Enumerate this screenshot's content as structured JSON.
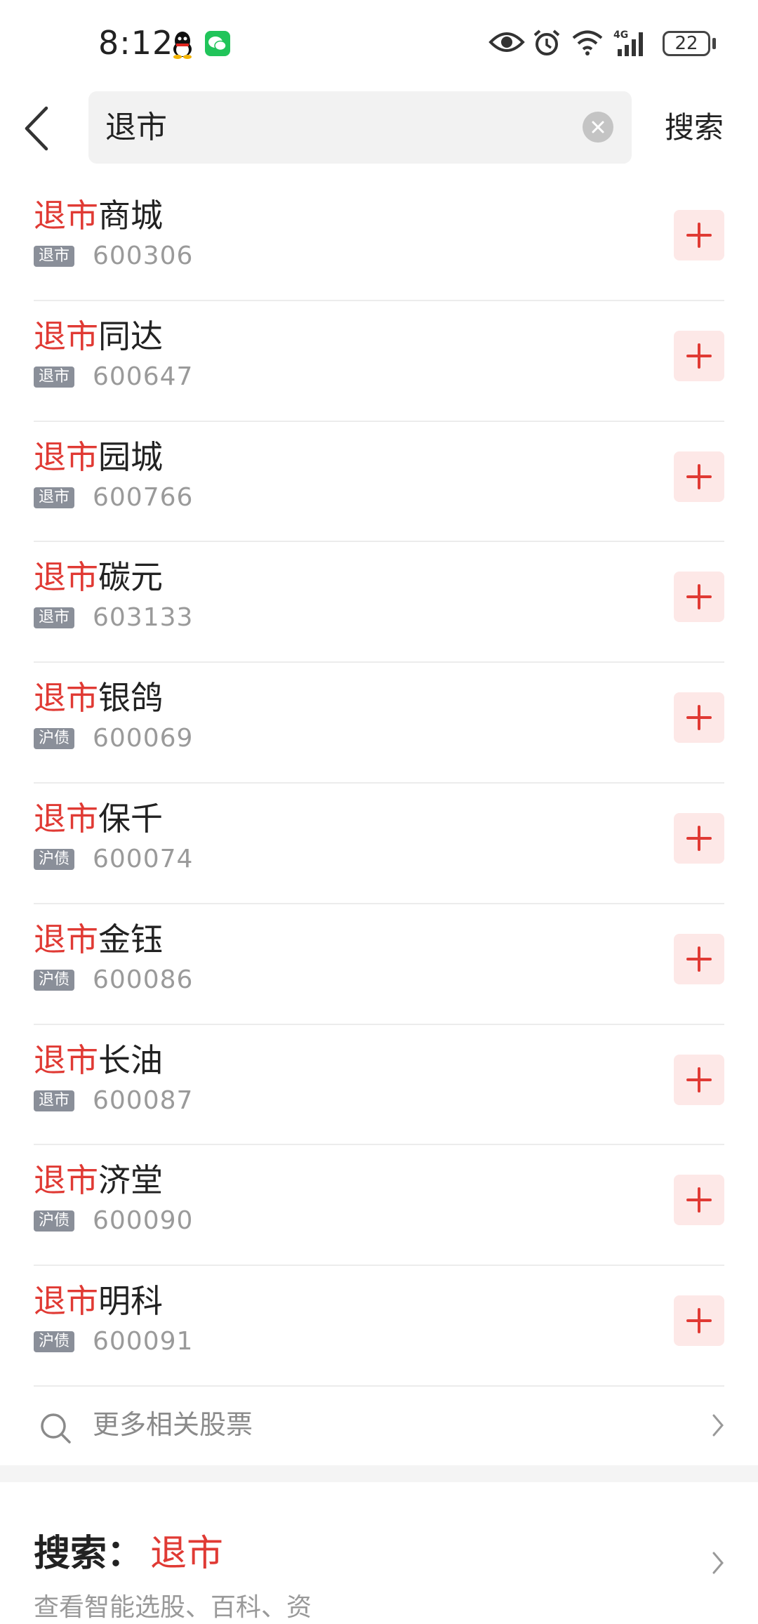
{
  "status_bar": {
    "time": "8:12",
    "battery": "22",
    "network": "4G"
  },
  "search": {
    "query": "退市",
    "submit_label": "搜索"
  },
  "results": [
    {
      "highlight": "退市",
      "rest": "商城",
      "tag": "退市",
      "code": "600306"
    },
    {
      "highlight": "退市",
      "rest": "同达",
      "tag": "退市",
      "code": "600647"
    },
    {
      "highlight": "退市",
      "rest": "园城",
      "tag": "退市",
      "code": "600766"
    },
    {
      "highlight": "退市",
      "rest": "碳元",
      "tag": "退市",
      "code": "603133"
    },
    {
      "highlight": "退市",
      "rest": "银鸽",
      "tag": "沪债",
      "code": "600069"
    },
    {
      "highlight": "退市",
      "rest": "保千",
      "tag": "沪债",
      "code": "600074"
    },
    {
      "highlight": "退市",
      "rest": "金钰",
      "tag": "沪债",
      "code": "600086"
    },
    {
      "highlight": "退市",
      "rest": "长油",
      "tag": "退市",
      "code": "600087"
    },
    {
      "highlight": "退市",
      "rest": "济堂",
      "tag": "沪债",
      "code": "600090"
    },
    {
      "highlight": "退市",
      "rest": "明科",
      "tag": "沪债",
      "code": "600091"
    }
  ],
  "more_stocks_label": "更多相关股票",
  "search_card": {
    "prefix": "搜索：",
    "keyword": "退市",
    "subtitle": "查看智能选股、百科、资"
  },
  "colors": {
    "accent": "#e03a34",
    "add_bg": "#fde8e7",
    "tag_bg": "#8a8f99"
  }
}
